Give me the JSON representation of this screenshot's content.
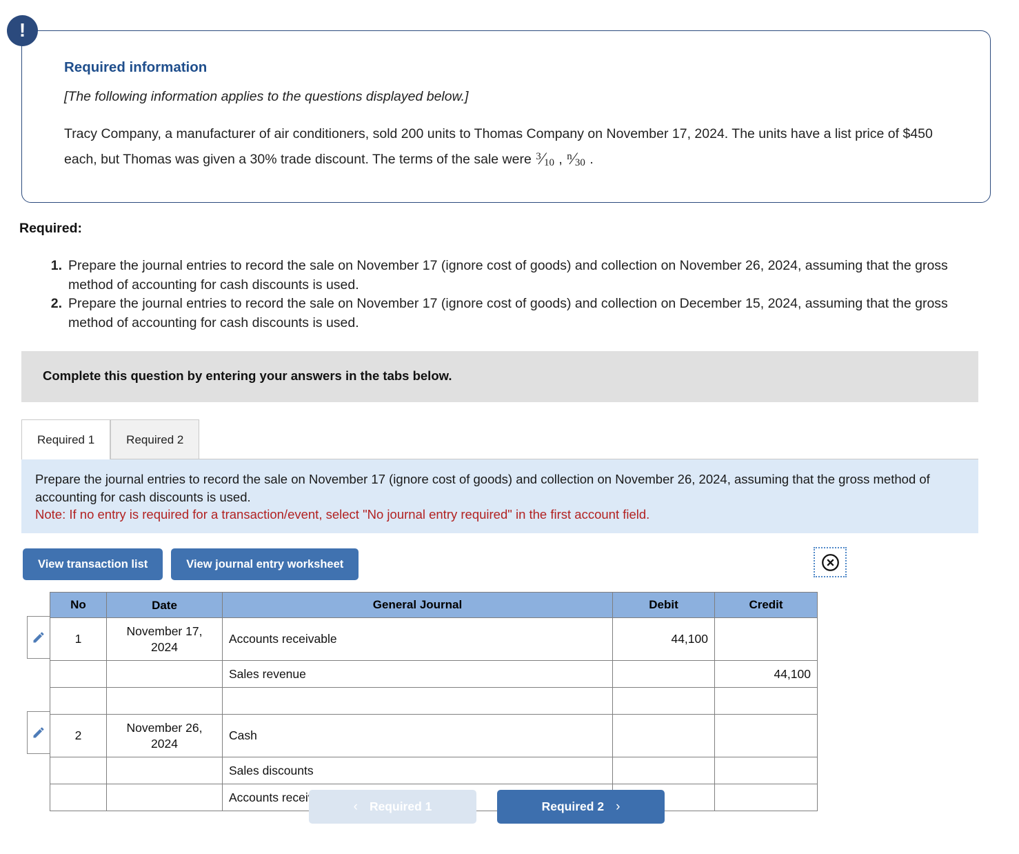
{
  "info_box": {
    "badge_icon": "exclamation-icon",
    "title": "Required information",
    "italic_line": "[The following information applies to the questions displayed below.]",
    "body_before_terms": "Tracy Company, a manufacturer of air conditioners, sold 200 units to Thomas Company on November 17, 2024. The units have a list price of $450 each, but Thomas was given a 30% trade discount. The terms of the sale were",
    "term1_num": "3",
    "term1_den": "10",
    "term_sep": ",",
    "term2_num": "n",
    "term2_den": "30",
    "body_after_terms": "."
  },
  "required": {
    "label": "Required:",
    "items": [
      {
        "num": "1.",
        "text": "Prepare the journal entries to record the sale on November 17 (ignore cost of goods) and collection on November 26, 2024, assuming that the gross method of accounting for cash discounts is used."
      },
      {
        "num": "2.",
        "text": "Prepare the journal entries to record the sale on November 17 (ignore cost of goods) and collection on December 15, 2024, assuming that the gross method of accounting for cash discounts is used."
      }
    ]
  },
  "grey_banner": {
    "text": "Complete this question by entering your answers in the tabs below."
  },
  "tabs": [
    {
      "label": "Required 1",
      "active": true
    },
    {
      "label": "Required 2",
      "active": false
    }
  ],
  "blue_note": {
    "instruction": "Prepare the journal entries to record the sale on November 17 (ignore cost of goods) and collection on November 26, 2024, assuming that the gross method of accounting for cash discounts is used.",
    "note": "Note: If no entry is required for a transaction/event, select \"No journal entry required\" in the first account field.",
    "note_color": "#b22222",
    "background_color": "#dce9f7"
  },
  "toolbar": {
    "view_transaction_list": "View transaction list",
    "view_worksheet": "View journal entry worksheet",
    "close_icon": "circle-x-icon",
    "button_color": "#4072b0"
  },
  "journal_table": {
    "header_color": "#8cb0de",
    "columns": [
      "No",
      "Date",
      "General Journal",
      "Debit",
      "Credit"
    ],
    "rows": [
      {
        "edit_icon": "pencil-icon",
        "no": "1",
        "date": "November 17, 2024",
        "account": "Accounts receivable",
        "indent": 0,
        "debit": "44,100",
        "credit": "",
        "tall": true
      },
      {
        "edit_icon": "",
        "no": "",
        "date": "",
        "account": "Sales revenue",
        "indent": 1,
        "debit": "",
        "credit": "44,100",
        "tall": false
      },
      {
        "edit_icon": "",
        "no": "",
        "date": "",
        "account": "",
        "indent": 0,
        "debit": "",
        "credit": "",
        "tall": false
      },
      {
        "edit_icon": "pencil-icon",
        "no": "2",
        "date": "November 26, 2024",
        "account": "Cash",
        "indent": 0,
        "debit": "",
        "credit": "",
        "tall": true
      },
      {
        "edit_icon": "",
        "no": "",
        "date": "",
        "account": "Sales discounts",
        "indent": 0,
        "debit": "",
        "credit": "",
        "tall": false
      },
      {
        "edit_icon": "",
        "no": "",
        "date": "",
        "account": "Accounts receivable",
        "indent": 0,
        "debit": "",
        "credit": "",
        "tall": false
      }
    ]
  },
  "pager": {
    "prev_label": "Required 1",
    "prev_icon": "chevron-left-icon",
    "prev_disabled": true,
    "next_label": "Required 2",
    "next_icon": "chevron-right-icon",
    "next_color": "#3d6fae"
  }
}
